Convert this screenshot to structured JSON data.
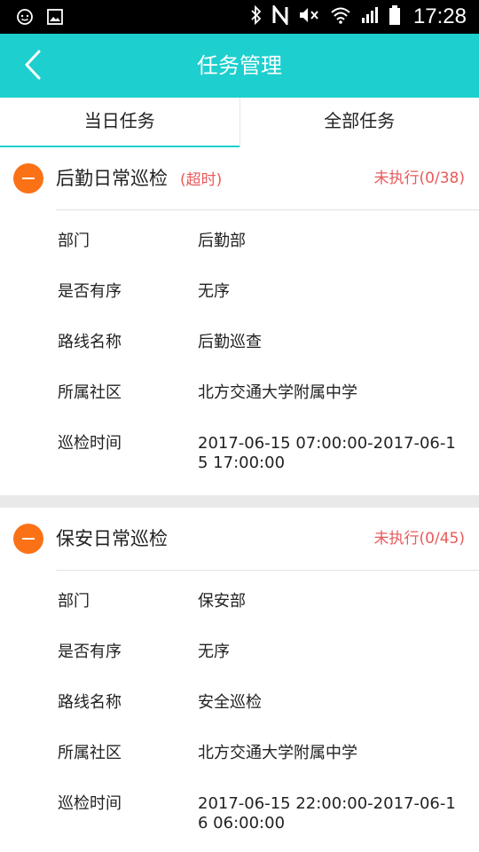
{
  "status_bar": {
    "time": "17:28",
    "icons": [
      "face-icon",
      "image-icon",
      "bluetooth-icon",
      "nfc-icon",
      "mute-icon",
      "wifi-icon",
      "signal-icon",
      "battery-icon"
    ]
  },
  "appbar": {
    "title": "任务管理",
    "back_icon": "chevron-left-icon"
  },
  "tabs": [
    {
      "label": "当日任务",
      "active": true
    },
    {
      "label": "全部任务",
      "active": false
    }
  ],
  "tasks": [
    {
      "title": "后勤日常巡检",
      "flag": "(超时)",
      "status": "未执行(0/38)",
      "rows": [
        {
          "label": "部门",
          "value": "后勤部"
        },
        {
          "label": "是否有序",
          "value": "无序"
        },
        {
          "label": "路线名称",
          "value": "后勤巡查"
        },
        {
          "label": "所属社区",
          "value": "北方交通大学附属中学"
        },
        {
          "label": "巡检时间",
          "value": "2017-06-15 07:00:00-2017-06-15 17:00:00"
        }
      ]
    },
    {
      "title": "保安日常巡检",
      "flag": "",
      "status": "未执行(0/45)",
      "rows": [
        {
          "label": "部门",
          "value": "保安部"
        },
        {
          "label": "是否有序",
          "value": "无序"
        },
        {
          "label": "路线名称",
          "value": "安全巡检"
        },
        {
          "label": "所属社区",
          "value": "北方交通大学附属中学"
        },
        {
          "label": "巡检时间",
          "value": "2017-06-15 22:00:00-2017-06-16 06:00:00"
        }
      ]
    }
  ],
  "colors": {
    "accent": "#1ecfcf",
    "orange": "#fb7216",
    "alert_red": "#e85a5a"
  }
}
